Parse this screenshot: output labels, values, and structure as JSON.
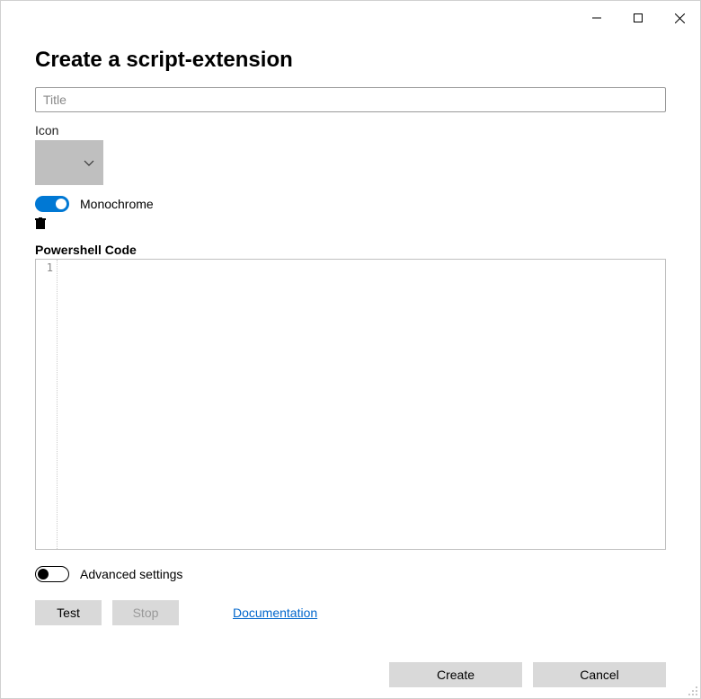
{
  "heading": "Create a script-extension",
  "title_field": {
    "placeholder": "Title",
    "value": ""
  },
  "icon_section": {
    "label": "Icon"
  },
  "monochrome": {
    "label": "Monochrome",
    "on": true
  },
  "code_section": {
    "label": "Powershell Code",
    "line_number": "1",
    "content": ""
  },
  "advanced": {
    "label": "Advanced settings",
    "on": false
  },
  "buttons": {
    "test": "Test",
    "stop": "Stop",
    "documentation": "Documentation",
    "create": "Create",
    "cancel": "Cancel"
  }
}
